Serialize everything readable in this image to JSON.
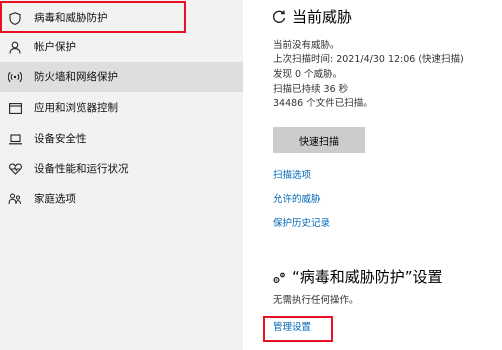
{
  "sidebar": {
    "items": [
      {
        "label": "病毒和威胁防护",
        "icon": "shield-icon"
      },
      {
        "label": "帐户保护",
        "icon": "person-icon"
      },
      {
        "label": "防火墙和网络保护",
        "icon": "wifi-icon"
      },
      {
        "label": "应用和浏览器控制",
        "icon": "app-window-icon"
      },
      {
        "label": "设备安全性",
        "icon": "laptop-icon"
      },
      {
        "label": "设备性能和运行状况",
        "icon": "heart-icon"
      },
      {
        "label": "家庭选项",
        "icon": "family-icon"
      }
    ],
    "selected_index": 2
  },
  "threats": {
    "title": "当前威胁",
    "icon": "refresh-shield-icon",
    "no_threats": "当前没有威胁。",
    "last_scan": "上次扫描时间: 2021/4/30 12:06 (快速扫描)",
    "found": "发现 0 个威胁。",
    "duration": "扫描已持续 36 秒",
    "files_scanned": "34486 个文件已扫描。",
    "scan_button": "快速扫描",
    "links": [
      "扫描选项",
      "允许的威胁",
      "保护历史记录"
    ]
  },
  "settings": {
    "title": "“病毒和威胁防护”设置",
    "icon": "gear-icon",
    "description": "无需执行任何操作。",
    "manage_link": "管理设置"
  },
  "colors": {
    "accent_link": "#0067b8",
    "highlight_border": "#e81123",
    "sidebar_bg": "#f2f2f2",
    "selected_bg": "#dedede",
    "button_bg": "#cccccc"
  }
}
